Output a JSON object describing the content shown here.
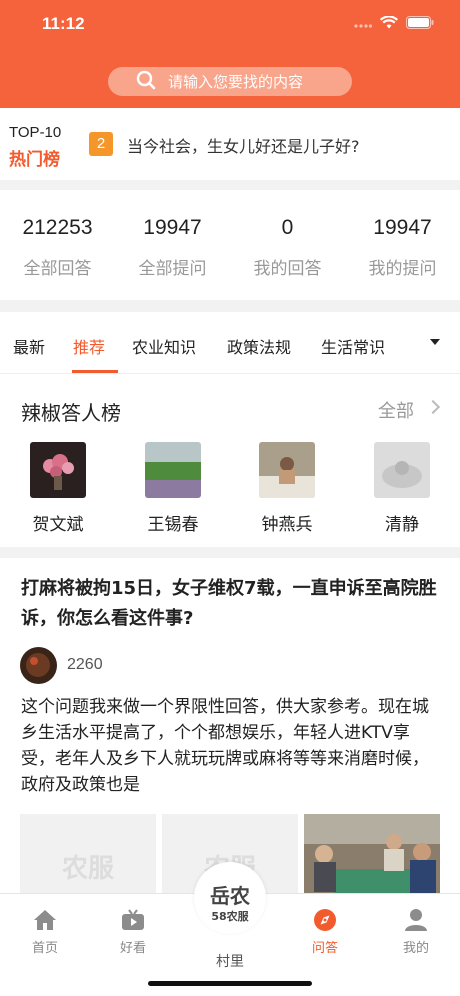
{
  "status_bar": {
    "time": "11:12"
  },
  "search": {
    "placeholder": "请输入您要找的内容"
  },
  "hot": {
    "top_label": "TOP-10",
    "title": "热门榜",
    "rank": "2",
    "question": "当今社会，生女儿好还是儿子好?"
  },
  "stats": [
    {
      "value": "212253",
      "label": "全部回答"
    },
    {
      "value": "19947",
      "label": "全部提问"
    },
    {
      "value": "0",
      "label": "我的回答"
    },
    {
      "value": "19947",
      "label": "我的提问"
    }
  ],
  "tabs": [
    "最新",
    "推荐",
    "农业知识",
    "政策法规",
    "生活常识"
  ],
  "active_tab": "推荐",
  "ranking": {
    "title": "辣椒答人榜",
    "all_label": "全部",
    "users": [
      "贺文斌",
      "王锡春",
      "钟燕兵",
      "清静"
    ]
  },
  "article": {
    "title": "打麻将被拘15日，女子维权7载，一直申诉至高院胜诉，你怎么看这件事?",
    "count": "2260",
    "body": "这个问题我来做一个界限性回答，供大家参考。现在城乡生活水平提高了，个个都想娱乐，年轻人进KTV享受，老年人及乡下人就玩玩牌或麻将等等来消磨时候，政府及政策也是",
    "thumb_watermark": "农服"
  },
  "bottom_nav": {
    "items": [
      "首页",
      "好看",
      "问答",
      "我的"
    ],
    "center_title": "岳农",
    "center_sub": "58农服",
    "center_label": "村里"
  },
  "colors": {
    "brand": "#f5633d",
    "accent": "#f25b2d",
    "badge": "#f5962a"
  }
}
